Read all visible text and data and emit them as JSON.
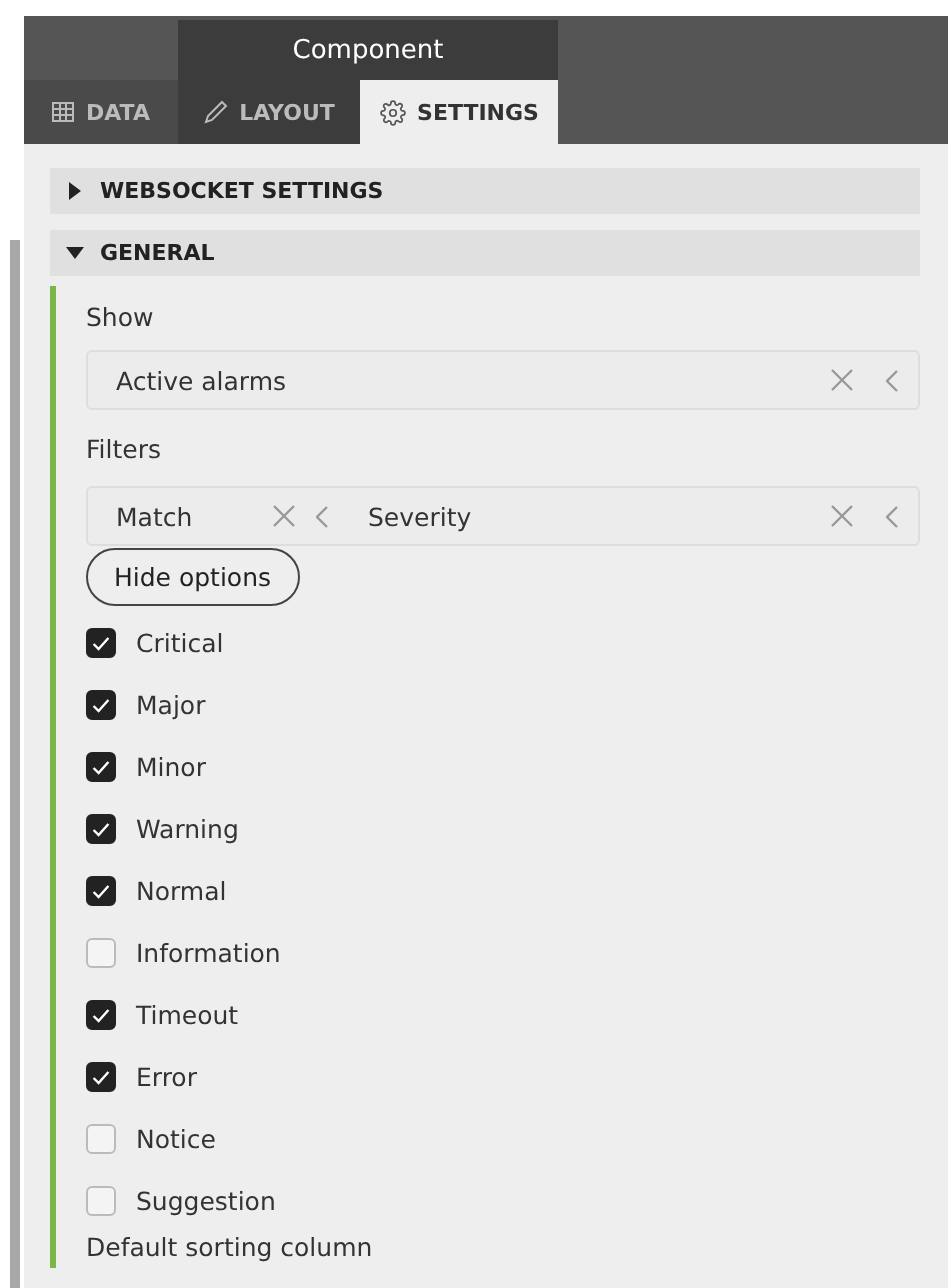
{
  "header": {
    "title": "Component"
  },
  "tabs": [
    {
      "label": "DATA",
      "selected": false
    },
    {
      "label": "LAYOUT",
      "selected": false
    },
    {
      "label": "SETTINGS",
      "selected": true
    }
  ],
  "sections": [
    {
      "title": "WEBSOCKET SETTINGS",
      "expanded": false
    },
    {
      "title": "GENERAL",
      "expanded": true
    }
  ],
  "show": {
    "label": "Show",
    "value": "Active alarms"
  },
  "filters": {
    "label": "Filters",
    "match": "Match",
    "field": "Severity"
  },
  "hide_button": "Hide options",
  "options": [
    {
      "label": "Critical",
      "checked": true
    },
    {
      "label": "Major",
      "checked": true
    },
    {
      "label": "Minor",
      "checked": true
    },
    {
      "label": "Warning",
      "checked": true
    },
    {
      "label": "Normal",
      "checked": true
    },
    {
      "label": "Information",
      "checked": false
    },
    {
      "label": "Timeout",
      "checked": true
    },
    {
      "label": "Error",
      "checked": true
    },
    {
      "label": "Notice",
      "checked": false
    },
    {
      "label": "Suggestion",
      "checked": false
    }
  ],
  "next_label": "Default sorting column"
}
